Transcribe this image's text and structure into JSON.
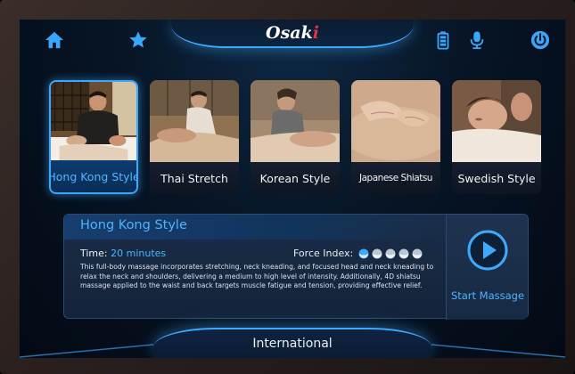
{
  "header": {
    "brand_main": "Osak",
    "brand_accent": "i",
    "icons": [
      "home-icon",
      "favorite-star-icon",
      "battery-icon",
      "microphone-icon",
      "power-icon"
    ]
  },
  "styles": [
    {
      "label": "Hong Kong Style",
      "selected": true
    },
    {
      "label": "Thai Stretch",
      "selected": false
    },
    {
      "label": "Korean Style",
      "selected": false
    },
    {
      "label": "Japanese Shiatsu",
      "selected": false
    },
    {
      "label": "Swedish Style",
      "selected": false
    }
  ],
  "detail": {
    "title": "Hong Kong Style",
    "time_label": "Time:",
    "time_value": "20 minutes",
    "force_label": "Force Index:",
    "force_level": 1,
    "force_max": 5,
    "description": "This full-body massage incorporates stretching, neck kneading, and focused head and neck kneading to relax the neck and shoulders, delivering a medium to high level of intensity. Additionally, 4D shiatsu massage applied to the waist and back targets muscle fatigue and tension, providing effective relief.",
    "start_label": "Start Massage"
  },
  "footer": {
    "mode_label": "International"
  },
  "colors": {
    "accent": "#3ea9ff",
    "accent_text": "#4db3ff",
    "brand_accent": "#e3344a",
    "background": "#071526"
  }
}
